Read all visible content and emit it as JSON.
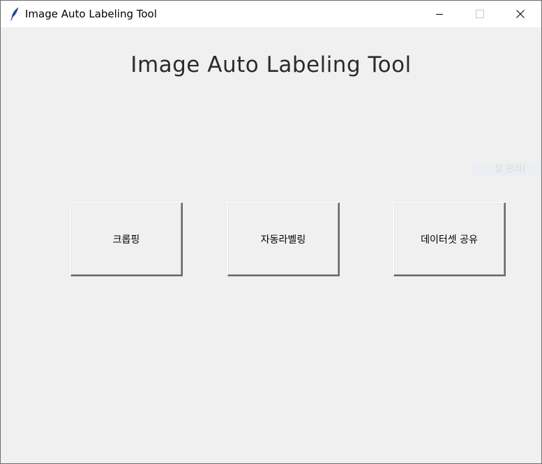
{
  "window": {
    "title": "Image Auto Labeling Tool",
    "icon": "feather-icon",
    "controls": [
      "minimize-icon",
      "maximize-icon",
      "close-icon"
    ]
  },
  "main": {
    "heading": "Image Auto Labeling Tool",
    "ghost_text": "장 관리(",
    "buttons": {
      "crop": "크롭핑",
      "auto_label": "자동라벨링",
      "share": "데이터셋 공유"
    }
  },
  "colors": {
    "background": "#f0f0f0",
    "titlebar": "#ffffff",
    "heading_text": "#2b2b2b"
  }
}
